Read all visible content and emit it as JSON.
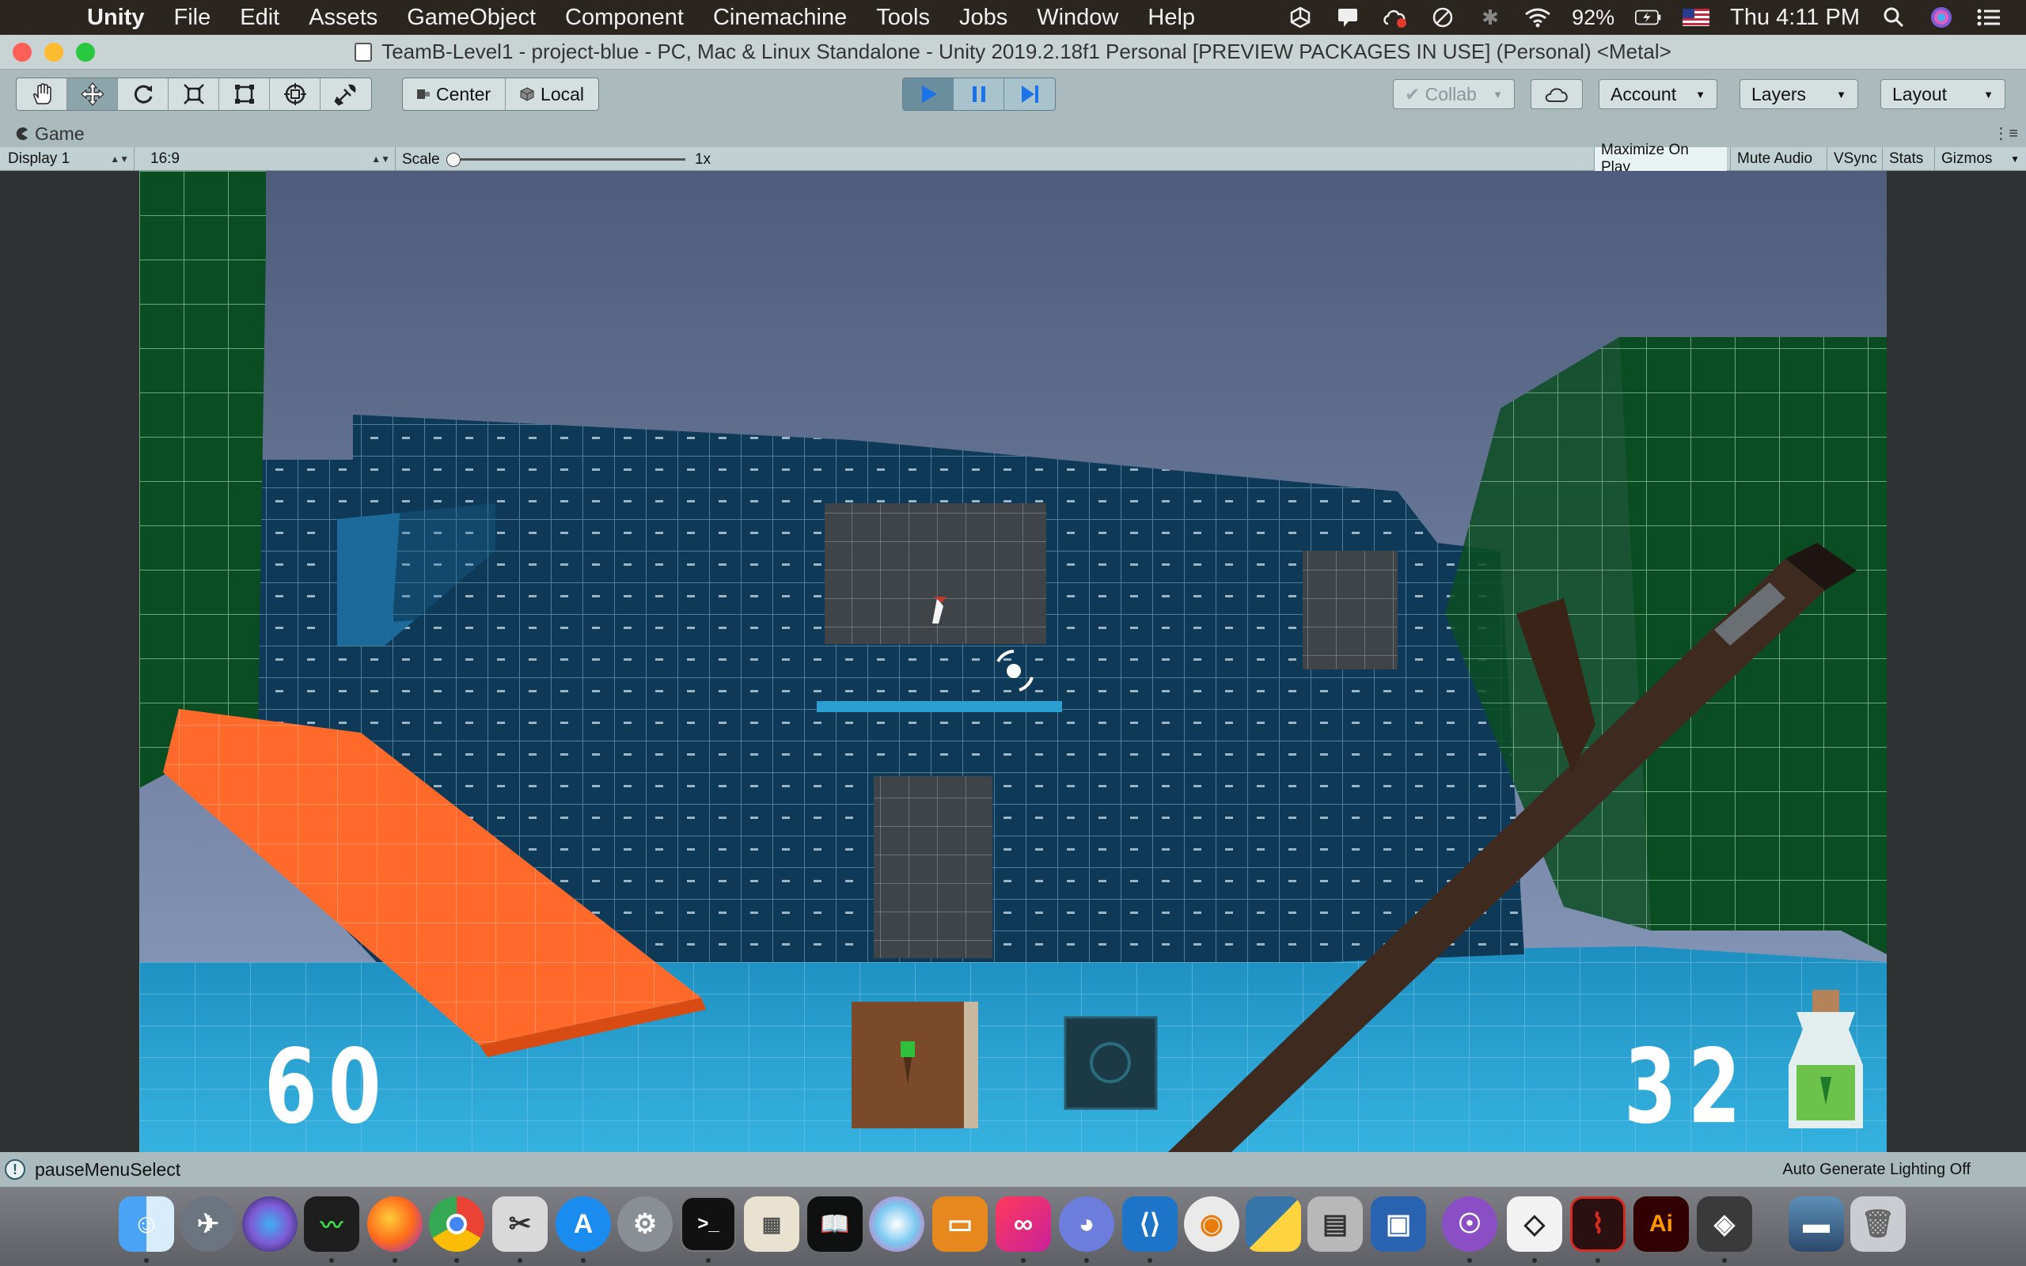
{
  "menubar": {
    "app_name": "Unity",
    "items": [
      "File",
      "Edit",
      "Assets",
      "GameObject",
      "Component",
      "Cinemachine",
      "Tools",
      "Jobs",
      "Window",
      "Help"
    ],
    "battery": "92%",
    "clock": "Thu 4:11 PM"
  },
  "window": {
    "title": "TeamB-Level1 - project-blue - PC, Mac & Linux Standalone - Unity 2019.2.18f1 Personal [PREVIEW PACKAGES IN USE] (Personal) <Metal>"
  },
  "toolbar": {
    "tools": [
      "hand-tool-icon",
      "move-tool-icon",
      "rotate-tool-icon",
      "scale-tool-icon",
      "rect-tool-icon",
      "transform-tool-icon",
      "custom-tool-icon"
    ],
    "pivot_center": "Center",
    "pivot_local": "Local",
    "collab": "Collab",
    "account": "Account",
    "layers": "Layers",
    "layout": "Layout"
  },
  "game_tab": {
    "label": "Game"
  },
  "gamebar": {
    "display": "Display 1",
    "aspect": "16:9",
    "scale_label": "Scale",
    "scale_value": "1x",
    "maximize_on_play": "Maximize On Play",
    "mute_audio": "Mute Audio",
    "vsync": "VSync",
    "stats": "Stats",
    "gizmos": "Gizmos"
  },
  "hud": {
    "left_count": "60",
    "right_count": "32"
  },
  "statusbar": {
    "message": "pauseMenuSelect",
    "lighting": "Auto Generate Lighting Off"
  },
  "colors": {
    "sky_top": "#4f5c7c",
    "sky_bottom": "#8fa0c0",
    "wall": "#0e3a57",
    "floor": "#2da3d1",
    "orange": "#ff6a2a",
    "green": "#0b4d22"
  },
  "dock": {
    "apps": [
      "finder",
      "launchpad",
      "siri",
      "activity-monitor",
      "firefox",
      "chrome",
      "screenshot",
      "app-store",
      "system-preferences",
      "terminal",
      "calculator",
      "kindle",
      "pixelmator",
      "slides",
      "creative-cloud",
      "discord",
      "vscode",
      "blender",
      "python",
      "disk-utility",
      "virtualbox",
      "github-desktop",
      "unity-hub",
      "acrobat",
      "illustrator",
      "unity",
      "photos",
      "trash"
    ]
  }
}
